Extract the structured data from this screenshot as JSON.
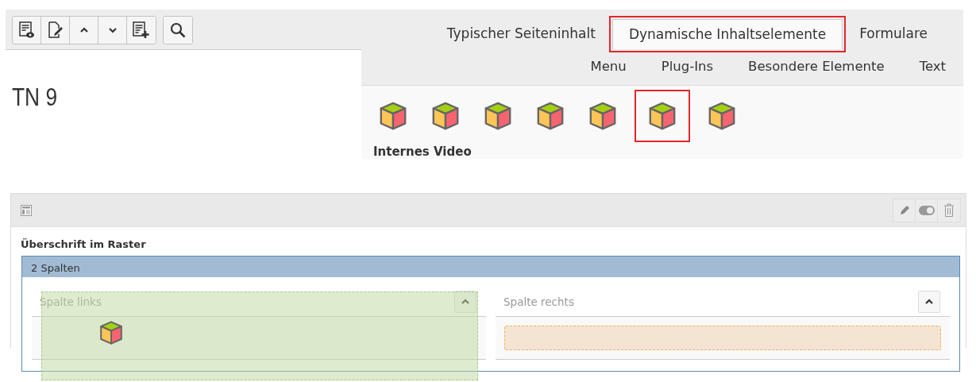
{
  "toolbar": {
    "groups": [
      [
        {
          "kind": "preview"
        },
        {
          "kind": "edit"
        },
        {
          "kind": "up"
        },
        {
          "kind": "down"
        },
        {
          "kind": "add"
        }
      ],
      [
        {
          "kind": "search"
        }
      ]
    ]
  },
  "page_heading": "TN 9",
  "wizard": {
    "tabs": [
      {
        "label": "Typischer Seiteninhalt",
        "selected": false
      },
      {
        "label": "Dynamische Inhaltselemente",
        "selected": true
      },
      {
        "label": "Formulare",
        "selected": false
      }
    ],
    "subtabs": [
      {
        "label": "Menu"
      },
      {
        "label": "Plug-Ins"
      },
      {
        "label": "Besondere Elemente"
      },
      {
        "label": "Text"
      }
    ],
    "elements": [
      {
        "selected": false
      },
      {
        "selected": false
      },
      {
        "selected": false
      },
      {
        "selected": false
      },
      {
        "selected": false
      },
      {
        "selected": true
      },
      {
        "selected": false
      }
    ],
    "element_title": "Internes Video"
  },
  "grid_element": {
    "title": "Überschrift im Raster",
    "grid_label": "2 Spalten",
    "columns": [
      {
        "title": "Spalte links",
        "kind": "source"
      },
      {
        "title": "Spalte rechts",
        "kind": "target"
      }
    ]
  }
}
